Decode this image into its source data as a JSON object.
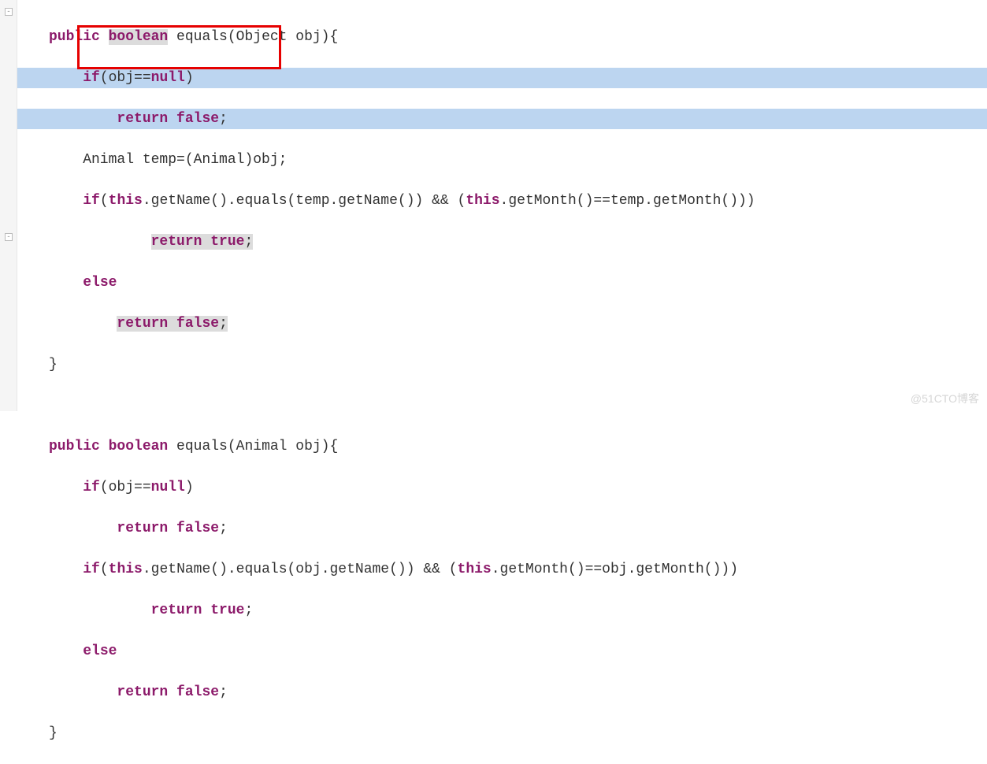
{
  "watermark": "@51CTO博客",
  "kw": {
    "public": "public",
    "boolean": "boolean",
    "return": "return",
    "if": "if",
    "else": "else",
    "null": "null",
    "this": "this",
    "true": "true",
    "false": "false"
  },
  "m1": {
    "sig_name": " equals(Object obj){",
    "l2a": "(obj==",
    "l2b": ")",
    "l3_end": ";",
    "l4": "    Animal temp=(Animal)obj;",
    "l5a": "(",
    "l5b": ".getName().equals(temp.getName()) && (",
    "l5c": ".getMonth()==temp.getMonth()))",
    "l6_end": ";",
    "l8_end": ";",
    "close": "}"
  },
  "m2": {
    "sig_name": " equals(Animal obj){",
    "l2a": "(obj==",
    "l2b": ")",
    "l3_end": ";",
    "l4a": "(",
    "l4b": ".getName().equals(obj.getName()) && (",
    "l4c": ".getMonth()==obj.getMonth()))",
    "l5_end": ";",
    "l7_end": ";",
    "close": "}"
  }
}
